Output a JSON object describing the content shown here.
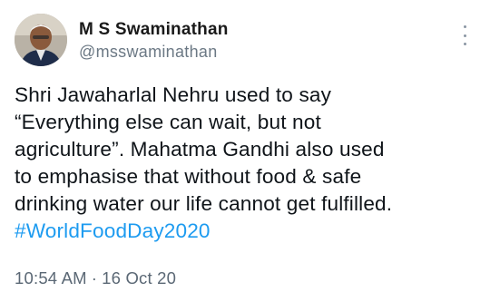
{
  "author": {
    "display_name": "M S Swaminathan",
    "handle": "@msswaminathan"
  },
  "tweet": {
    "lines": [
      "Shri Jawaharlal Nehru used to say",
      "“Everything else can wait, but not",
      "agriculture”. Mahatma Gandhi also used",
      "to emphasise that without food & safe",
      "drinking water our life cannot get fulfilled."
    ],
    "hashtag": "#WorldFoodDay2020"
  },
  "meta": {
    "time": "10:54 AM",
    "separator": "·",
    "date": "16 Oct 20"
  },
  "icons": {
    "more": "more-vertical-icon"
  },
  "colors": {
    "hashtag": "#1d9bf0",
    "text": "#0f1419",
    "secondary": "#6b7884"
  }
}
